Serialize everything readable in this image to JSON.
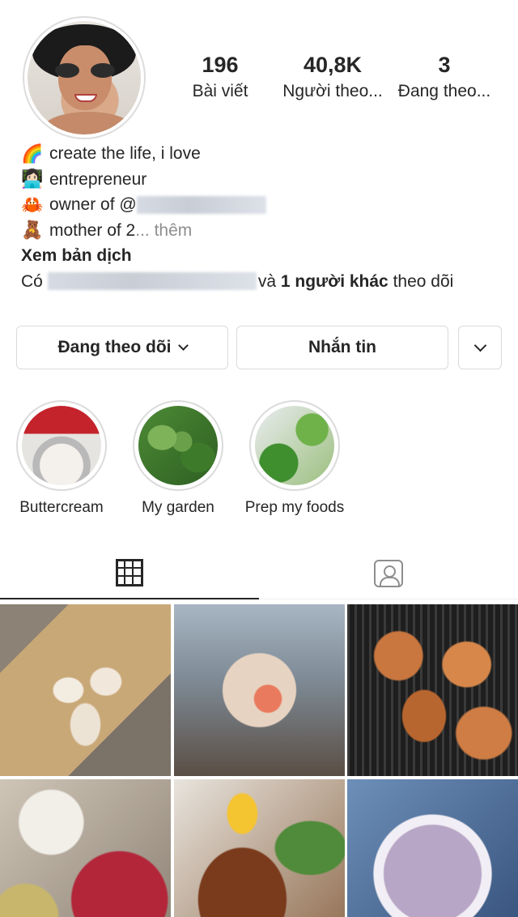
{
  "profile": {
    "stats": {
      "posts": {
        "value": "196",
        "label": "Bài viết"
      },
      "followers": {
        "value": "40,8K",
        "label": "Người theo..."
      },
      "following": {
        "value": "3",
        "label": "Đang theo..."
      }
    },
    "bio": {
      "lines": [
        {
          "emoji": "🌈",
          "icon": "rainbow-icon",
          "text": "create the life, i love"
        },
        {
          "emoji": "👩🏻‍💻",
          "icon": "woman-technologist-icon",
          "text": "entrepreneur"
        },
        {
          "emoji": "🦀",
          "icon": "crab-icon",
          "text": "owner of @"
        },
        {
          "emoji": "🧸",
          "icon": "teddy-bear-icon",
          "text": "mother of 2",
          "more": "... thêm"
        }
      ],
      "translate": "Xem bản dịch",
      "followed_by_prefix": "Có",
      "followed_by_mid": "và",
      "followed_by_bold": "1 người khác",
      "followed_by_suffix": "theo dõi"
    }
  },
  "actions": {
    "following_label": "Đang theo dõi",
    "message_label": "Nhắn tin"
  },
  "highlights": [
    {
      "label": "Buttercream"
    },
    {
      "label": "My garden"
    },
    {
      "label": "Prep my foods"
    }
  ],
  "tabs": {
    "active": "grid",
    "items": [
      {
        "name": "grid",
        "icon": "grid-icon"
      },
      {
        "name": "tagged",
        "icon": "tagged-icon"
      }
    ]
  },
  "posts": [
    {
      "subject": "eggs in a box"
    },
    {
      "subject": "sandwich"
    },
    {
      "subject": "roasted pork belly"
    },
    {
      "subject": "noodle soup ingredients"
    },
    {
      "subject": "grilled ribs and corn"
    },
    {
      "subject": "taro soup"
    }
  ],
  "colors": {
    "text": "#262626",
    "muted": "#8e8e8e",
    "border": "#dbdbdb"
  }
}
